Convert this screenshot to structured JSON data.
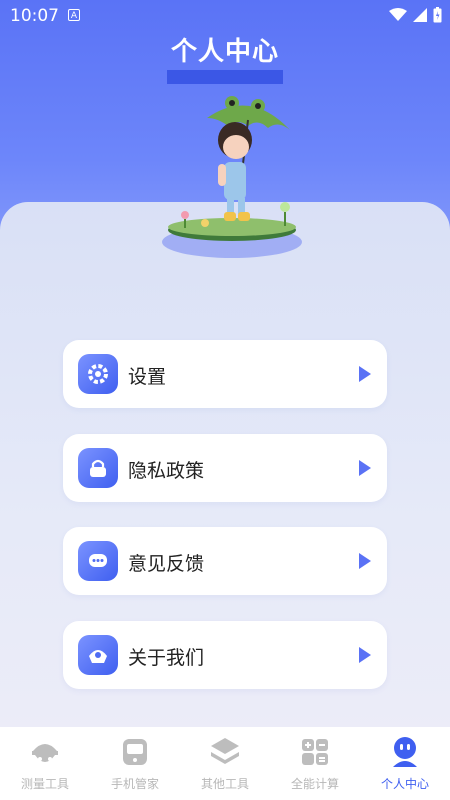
{
  "status_bar": {
    "time": "10:07",
    "indicator": "A"
  },
  "header": {
    "title": "个人中心"
  },
  "mascot": {
    "icon": "girl-with-umbrella-illustration"
  },
  "menu": {
    "items": [
      {
        "label": "设置",
        "icon": "settings-icon"
      },
      {
        "label": "隐私政策",
        "icon": "privacy-lock-icon"
      },
      {
        "label": "意见反馈",
        "icon": "feedback-chat-icon"
      },
      {
        "label": "关于我们",
        "icon": "about-us-icon"
      }
    ]
  },
  "tabbar": {
    "tabs": [
      {
        "label": "测量工具",
        "icon": "measure-tool-icon",
        "active": false
      },
      {
        "label": "手机管家",
        "icon": "phone-manager-icon",
        "active": false
      },
      {
        "label": "其他工具",
        "icon": "other-tools-icon",
        "active": false
      },
      {
        "label": "全能计算",
        "icon": "calculator-icon",
        "active": false
      },
      {
        "label": "个人中心",
        "icon": "profile-icon",
        "active": true
      }
    ]
  },
  "colors": {
    "accent": "#3f5ff0",
    "hero": "#5a73f6",
    "inactive": "#b7b7b7"
  }
}
